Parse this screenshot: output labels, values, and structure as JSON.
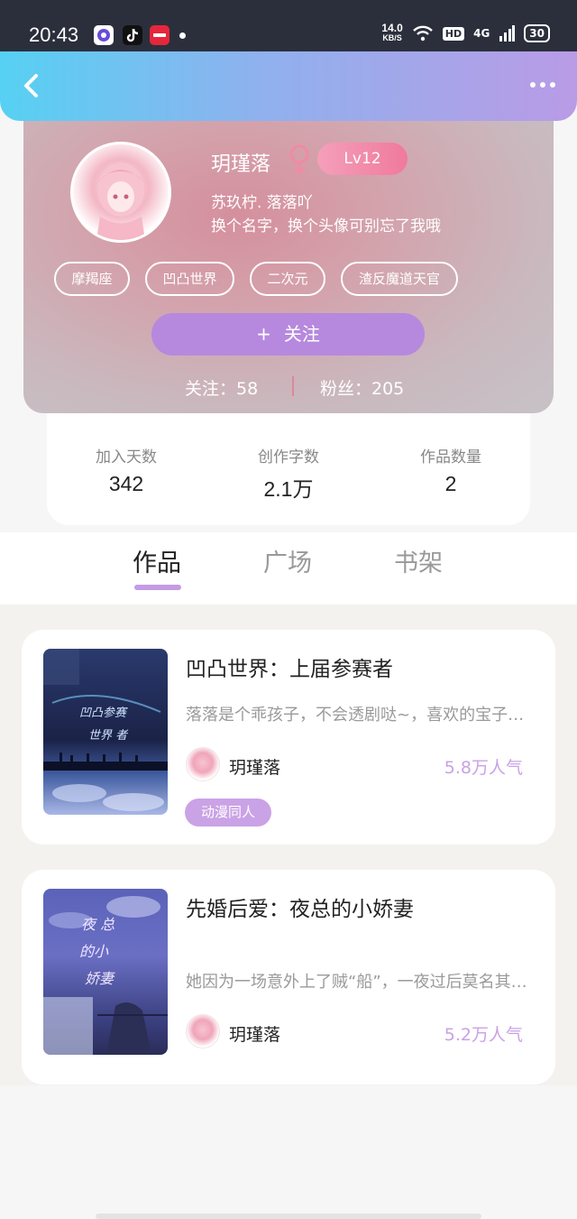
{
  "status_bar": {
    "time": "20:43",
    "net_speed": "14.0",
    "net_unit": "KB/S",
    "hd": "HD",
    "signal": "4G",
    "battery": "30"
  },
  "nav": {
    "back_icon": "chevron-left-icon",
    "more_icon": "more-dots-icon"
  },
  "profile": {
    "username": "玥瑾落",
    "gender_symbol": "♀",
    "level": "Lv12",
    "bio_line1": "苏玖柠. 落落吖",
    "bio_line2": "换个名字，换个头像可别忘了我哦",
    "tags": [
      "摩羯座",
      "凹凸世界",
      "二次元",
      "渣反魔道天官"
    ],
    "follow_plus": "+",
    "follow_label": "关注",
    "following_text": "关注：58",
    "fans_text": "粉丝：205"
  },
  "metrics": [
    {
      "label": "加入天数",
      "value": "342"
    },
    {
      "label": "创作字数",
      "value": "2.1万"
    },
    {
      "label": "作品数量",
      "value": "2"
    }
  ],
  "tabs": [
    {
      "label": "作品",
      "active": true
    },
    {
      "label": "广场",
      "active": false
    },
    {
      "label": "书架",
      "active": false
    }
  ],
  "works": [
    {
      "title": "凹凸世界：上届参赛者",
      "desc": "落落是个乖孩子，不会透剧哒~，喜欢的宝子们…",
      "author": "玥瑾落",
      "popularity": "5.8万人气",
      "genre": "动漫同人"
    },
    {
      "title": "先婚后爱：夜总的小娇妻",
      "desc": "她因为一场意外上了贼“船”，一夜过后莫名其妙…",
      "author": "玥瑾落",
      "popularity": "5.2万人气",
      "genre": ""
    }
  ],
  "colors": {
    "accent": "#b689de",
    "level_badge": "#f07a9c",
    "popularity": "#c9a1e7",
    "topbar_start": "#56d1f3",
    "topbar_end": "#b99be6"
  }
}
